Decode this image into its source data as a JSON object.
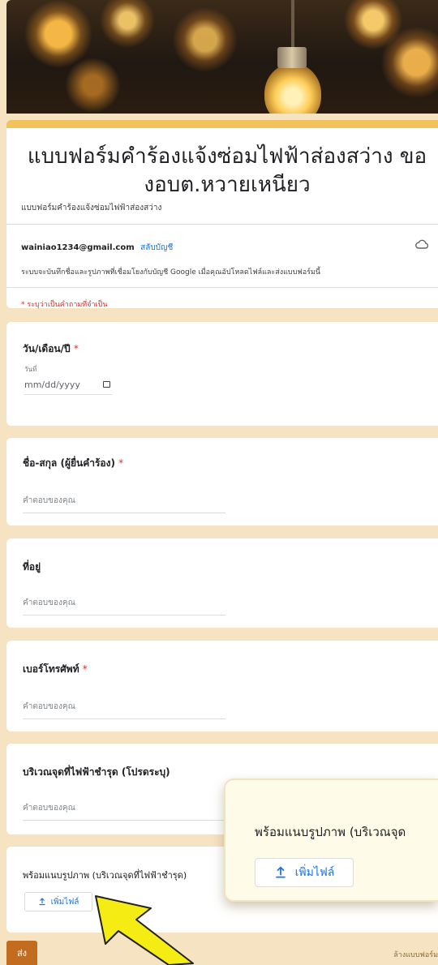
{
  "form": {
    "title": "แบบฟอร์มคำร้องแจ้งซ่อมไฟฟ้าส่องสว่าง ของอบต.หวายเหนียว",
    "description": "แบบฟอร์มคำร้องแจ้งซ่อมไฟฟ้าส่องสว่าง",
    "email": "wainiao1234@gmail.com",
    "switch_account": "สลับบัญชี",
    "notice": "ระบบจะบันทึกชื่อและรูปภาพที่เชื่อมโยงกับบัญชี Google เมื่อคุณอัปโหลดไฟล์และส่งแบบฟอร์มนี้",
    "required_note": "* ระบุว่าเป็นคำถามที่จำเป็น"
  },
  "questions": {
    "date": {
      "label": "วัน/เดือน/ปี",
      "sub": "วันที่",
      "placeholder": "mm/dd/yyyy"
    },
    "name": {
      "label": "ชื่อ-สกุล (ผู้ยื่นคำร้อง)",
      "placeholder": "คำตอบของคุณ"
    },
    "address": {
      "label": "ที่อยู่",
      "placeholder": "คำตอบของคุณ"
    },
    "phone": {
      "label": "เบอร์โทรศัพท์",
      "placeholder": "คำตอบของคุณ"
    },
    "location": {
      "label": "บริเวณจุดที่ไฟฟ้าชำรุด (โปรดระบุ)",
      "placeholder": "คำตอบของคุณ"
    },
    "photo": {
      "label": "พร้อมแนบรูปภาพ (บริเวณจุดที่ไฟฟ้าชำรุด)",
      "upload_label": "เพิ่มไฟล์"
    }
  },
  "required_mark": "*",
  "footer": {
    "submit": "ส่ง",
    "clear": "ล้างแบบฟอร์ม"
  },
  "zoom": {
    "label": "พร้อมแนบรูปภาพ (บริเวณจุด",
    "upload_label": "เพิ่มไฟล์"
  },
  "colors": {
    "accent": "#f2c25f",
    "page_bg": "#f6e3c1",
    "submit": "#c26c1f",
    "link": "#1a73e8",
    "required": "#d93025",
    "arrow": "#f5ec14"
  }
}
